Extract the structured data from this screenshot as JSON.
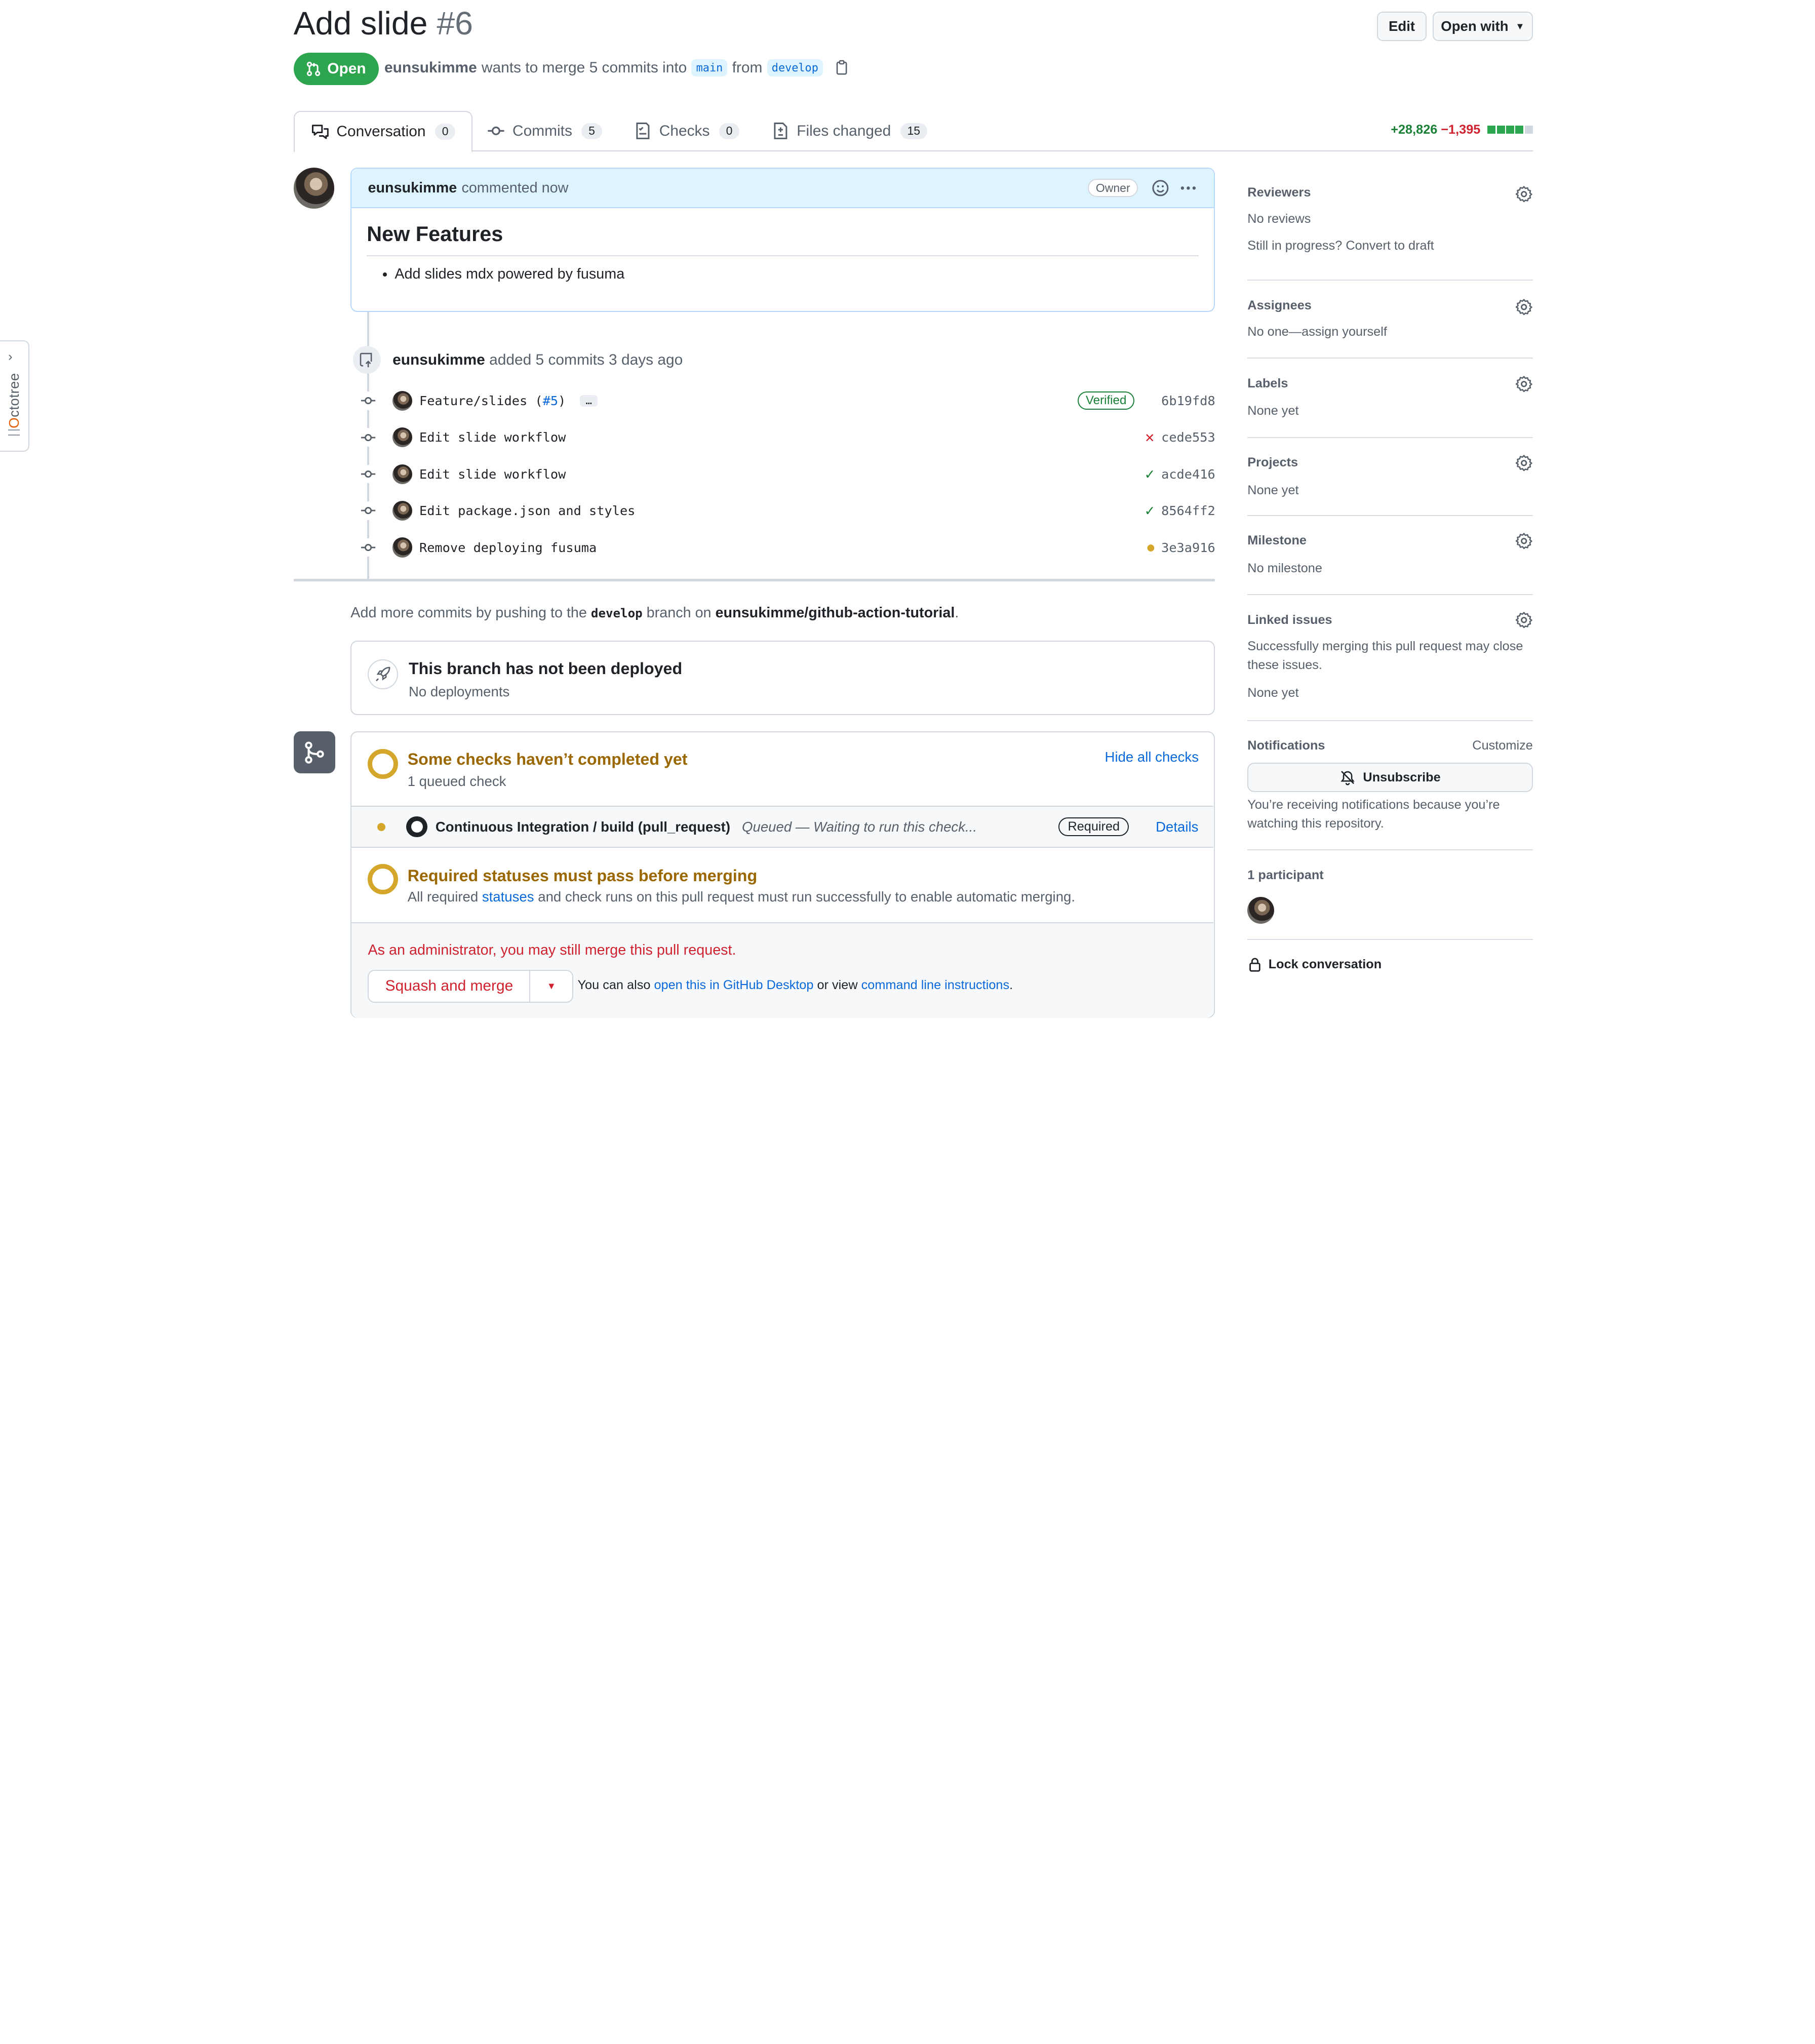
{
  "octotree": {
    "label_prefix": "O",
    "label_rest": "ctotree"
  },
  "header": {
    "title": "Add slide",
    "number": "#6",
    "edit_label": "Edit",
    "open_with_label": "Open with",
    "state": "Open",
    "author": "eunsukimme",
    "merge_text": "wants to merge 5 commits into",
    "base_branch": "main",
    "from_text": "from",
    "head_branch": "develop"
  },
  "tabs": [
    {
      "label": "Conversation",
      "count": "0",
      "icon": "comment-discussion-icon"
    },
    {
      "label": "Commits",
      "count": "5",
      "icon": "git-commit-icon"
    },
    {
      "label": "Checks",
      "count": "0",
      "icon": "checklist-icon"
    },
    {
      "label": "Files changed",
      "count": "15",
      "icon": "file-diff-icon"
    }
  ],
  "diffstat": {
    "additions": "+28,826",
    "deletions": "−1,395",
    "blocks": [
      "#2da44e",
      "#2da44e",
      "#2da44e",
      "#2da44e",
      "#d0d7de"
    ]
  },
  "comment": {
    "author": "eunsukimme",
    "time": "commented now",
    "badge": "Owner",
    "heading": "New Features",
    "bullet": "Add slides mdx powered by fusuma"
  },
  "commits_event": {
    "author": "eunsukimme",
    "text": "added 5 commits 3 days ago"
  },
  "commits": [
    {
      "message": "Feature/slides (",
      "pr_link": "#5",
      "message_tail": ")",
      "ellipsis": "…",
      "verified": "Verified",
      "status": "none",
      "sha": "6b19fd8"
    },
    {
      "message": "Edit slide workflow",
      "status": "fail",
      "status_glyph": "✕",
      "sha": "cede553"
    },
    {
      "message": "Edit slide workflow",
      "status": "success",
      "status_glyph": "✓",
      "sha": "acde416"
    },
    {
      "message": "Edit package.json and styles",
      "status": "success",
      "status_glyph": "✓",
      "sha": "8564ff2"
    },
    {
      "message": "Remove deploying fusuma",
      "status": "pending",
      "status_glyph": "●",
      "sha": "3e3a916"
    }
  ],
  "push_info": {
    "prefix": "Add more commits by pushing to the",
    "branch": "develop",
    "middle": "branch on",
    "repo": "eunsukimme/github-action-tutorial",
    "suffix": "."
  },
  "deploy": {
    "title": "This branch has not been deployed",
    "subtitle": "No deployments"
  },
  "checks": {
    "title": "Some checks haven’t completed yet",
    "subtitle": "1 queued check",
    "hide_all": "Hide all checks",
    "row_name": "Continuous Integration / build (pull_request)",
    "row_status": "Queued — Waiting to run this check...",
    "row_badge": "Required",
    "row_details": "Details",
    "req_title": "Required statuses must pass before merging",
    "req_prefix": "All required",
    "req_link": "statuses",
    "req_suffix": "and check runs on this pull request must run successfully to enable automatic merging.",
    "admin_warning": "As an administrator, you may still merge this pull request.",
    "squash_label": "Squash and merge",
    "also_prefix": "You can also",
    "also_link1": "open this in GitHub Desktop",
    "also_middle": "or view",
    "also_link2": "command line instructions",
    "also_suffix": "."
  },
  "sidebar": {
    "reviewers": {
      "title": "Reviewers",
      "value": "No reviews",
      "extra": "Still in progress? Convert to draft"
    },
    "assignees": {
      "title": "Assignees",
      "value": "No one—assign yourself"
    },
    "labels": {
      "title": "Labels",
      "value": "None yet"
    },
    "projects": {
      "title": "Projects",
      "value": "None yet"
    },
    "milestone": {
      "title": "Milestone",
      "value": "No milestone"
    },
    "linked": {
      "title": "Linked issues",
      "desc": "Successfully merging this pull request may close these issues.",
      "value": "None yet"
    },
    "notifications": {
      "title": "Notifications",
      "customize": "Customize",
      "button": "Unsubscribe",
      "desc": "You’re receiving notifications because you’re watching this repository."
    },
    "participants": {
      "title": "1 participant"
    },
    "lock": "Lock conversation"
  },
  "colors": {
    "open_green": "#2da44e",
    "link_blue": "#0969da",
    "pending_yellow": "#d4a72c",
    "danger_red": "#cf222e"
  }
}
